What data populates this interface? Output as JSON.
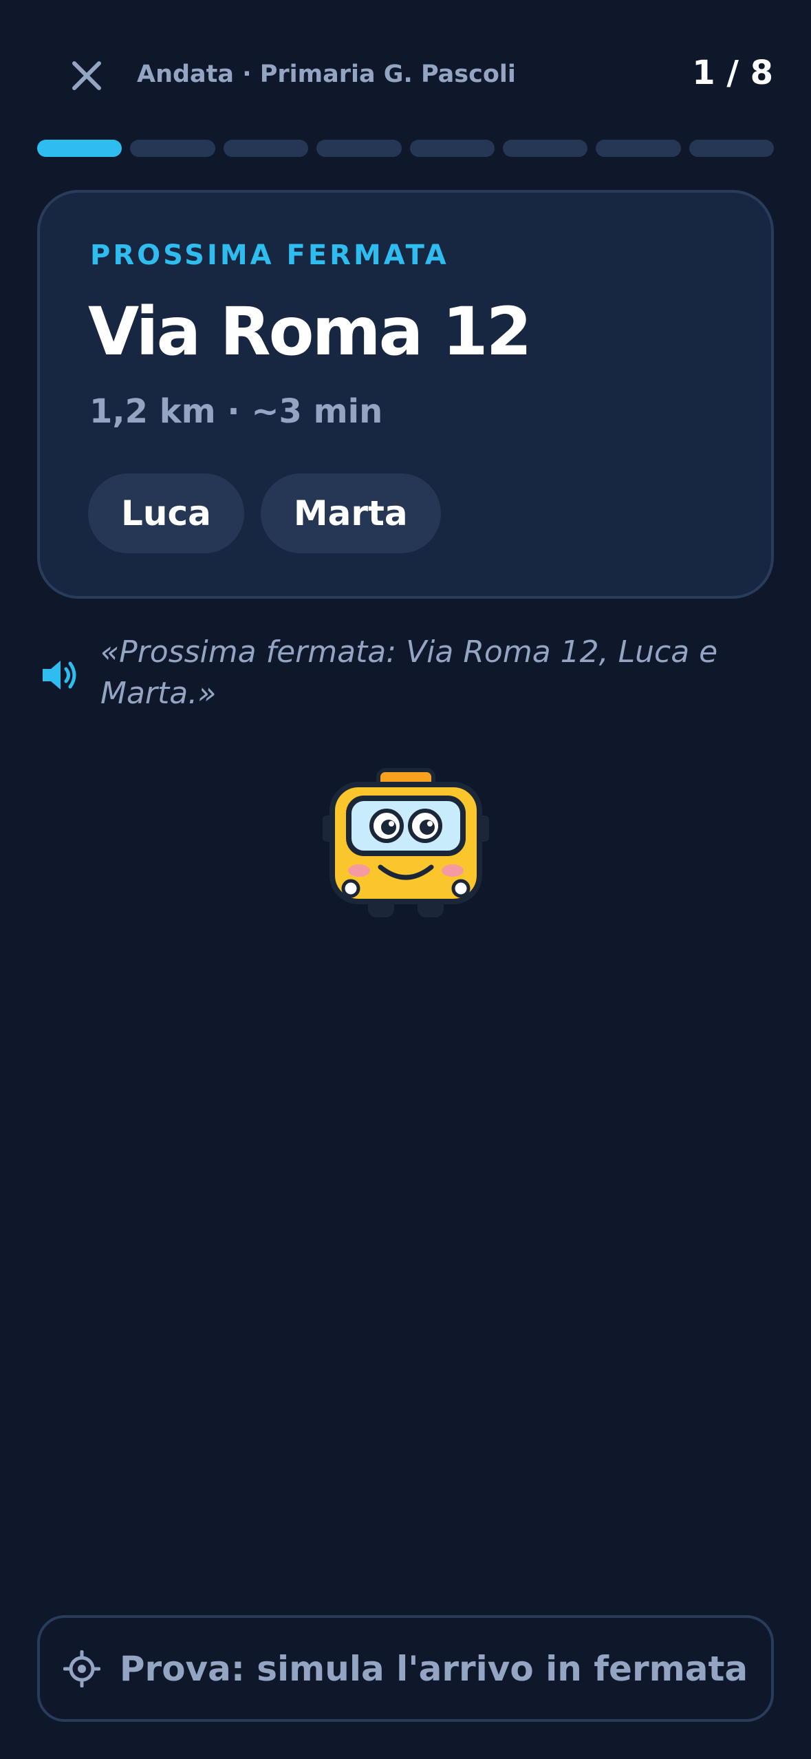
{
  "header": {
    "route_title": "Andata · Primaria G. Pascoli",
    "step_counter": "1 / 8",
    "close_icon": "close-icon"
  },
  "progress": {
    "current_step": 1,
    "total_steps": 8
  },
  "stop_card": {
    "label": "PROSSIMA FERMATA",
    "stop_name": "Via Roma 12",
    "meta": "1,2 km · ~3 min",
    "children": [
      "Luca",
      "Marta"
    ]
  },
  "announcement": {
    "icon": "speaker-icon",
    "text": "«Prossima fermata: Via Roma 12, Luca e Marta.»"
  },
  "mascot": {
    "icon": "bus-mascot"
  },
  "simulate_button": {
    "icon": "location-target-icon",
    "label": "Prova: simula l'arrivo in fermata"
  },
  "colors": {
    "background": "#0f182a",
    "card": "#182741",
    "accent": "#2fbdf0",
    "muted_text": "#93a5c2",
    "mascot_yellow": "#fbc52c"
  }
}
